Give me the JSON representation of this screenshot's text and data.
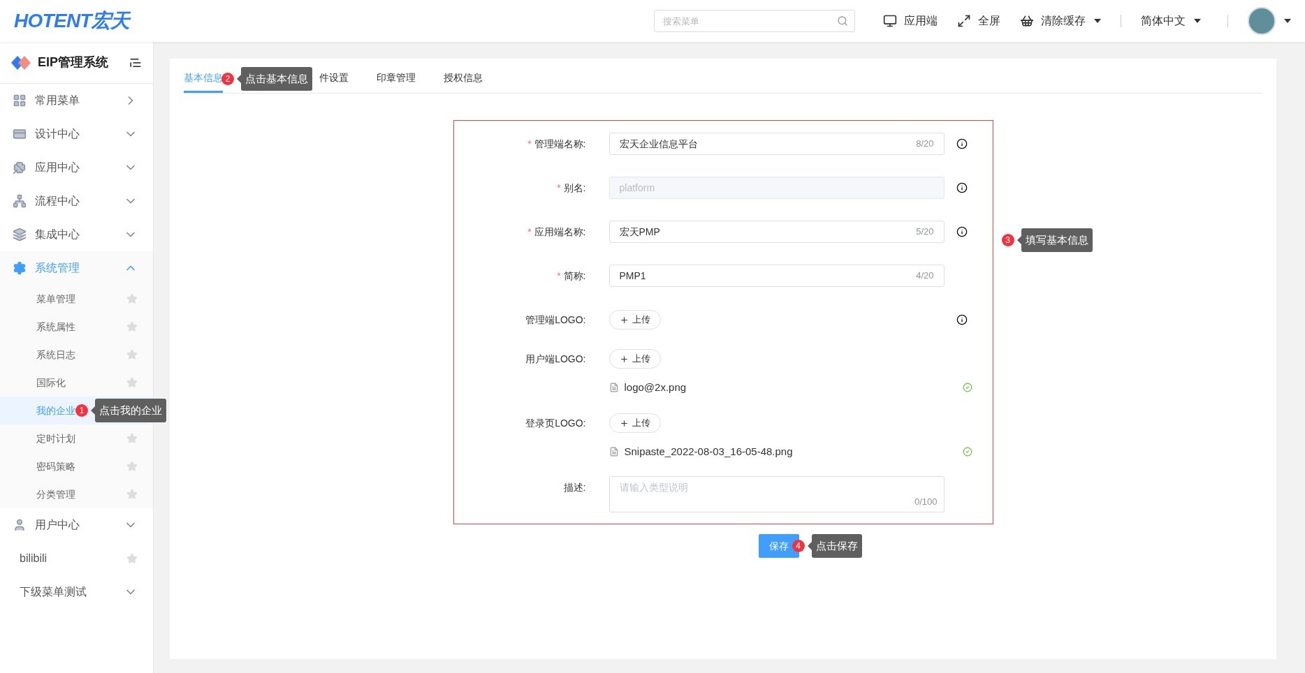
{
  "header": {
    "logo": "HOTENT宏天",
    "search": {
      "placeholder": "搜索菜单"
    },
    "actions": [
      {
        "label": "应用端",
        "dropdown": false
      },
      {
        "label": "全屏",
        "dropdown": false
      },
      {
        "label": "清除缓存",
        "dropdown": true
      }
    ],
    "language": "简体中文"
  },
  "sidebar": {
    "title": "EIP管理系统",
    "items": [
      {
        "kind": "flyout",
        "label": "常用菜单"
      },
      {
        "kind": "group",
        "label": "设计中心",
        "expanded": false
      },
      {
        "kind": "group",
        "label": "应用中心",
        "expanded": false
      },
      {
        "kind": "group",
        "label": "流程中心",
        "expanded": false
      },
      {
        "kind": "group",
        "label": "集成中心",
        "expanded": false
      },
      {
        "kind": "group",
        "label": "系统管理",
        "expanded": true,
        "children": [
          {
            "label": "菜单管理",
            "selected": false
          },
          {
            "label": "系统属性",
            "selected": false
          },
          {
            "label": "系统日志",
            "selected": false
          },
          {
            "label": "国际化",
            "selected": false
          },
          {
            "label": "我的企业",
            "selected": true,
            "annotation": {
              "number": "1",
              "text": "点击我的企业"
            }
          },
          {
            "label": "定时计划",
            "selected": false
          },
          {
            "label": "密码策略",
            "selected": false
          },
          {
            "label": "分类管理",
            "selected": false
          }
        ]
      },
      {
        "kind": "group",
        "label": "用户中心",
        "expanded": false
      },
      {
        "kind": "leaf",
        "label": "bilibili"
      },
      {
        "kind": "group",
        "label": "下级菜单测试",
        "expanded": false
      }
    ]
  },
  "tabs": [
    {
      "label": "基本信息",
      "selected": true,
      "annotation": {
        "number": "2",
        "text": "点击基本信息"
      }
    },
    {
      "label": "件设置",
      "selected": false
    },
    {
      "label": "印章管理",
      "selected": false
    },
    {
      "label": "授权信息",
      "selected": false
    }
  ],
  "form": {
    "annotation": {
      "number": "3",
      "text": "填写基本信息"
    },
    "fields": [
      {
        "kind": "input",
        "marker": "*",
        "label": "管理端名称:",
        "value": "宏天企业信息平台",
        "counter": "8/20",
        "disabled": false,
        "info": true
      },
      {
        "kind": "input",
        "marker": "*",
        "label": "别名:",
        "value": "platform",
        "disabled": true,
        "info": true
      },
      {
        "kind": "input",
        "marker": "*",
        "label": "应用端名称:",
        "value": "宏天PMP",
        "counter": "5/20",
        "disabled": false,
        "info": true
      },
      {
        "kind": "input",
        "marker": "*",
        "label": "简称:",
        "value": "PMP1",
        "counter": "4/20",
        "disabled": false,
        "info": false
      },
      {
        "kind": "upload",
        "label": "管理端LOGO:",
        "button": "上传",
        "info": true
      },
      {
        "kind": "upload",
        "label": "用户端LOGO:",
        "button": "上传",
        "info": false,
        "files": [
          "logo@2x.png"
        ]
      },
      {
        "kind": "upload",
        "label": "登录页LOGO:",
        "button": "上传",
        "info": false,
        "files": [
          "Snipaste_2022-08-03_16-05-48.png"
        ]
      },
      {
        "kind": "textarea",
        "label": "描述:",
        "placeholder": "请输入类型说明",
        "counter": "0/100"
      }
    ]
  },
  "save": {
    "label": "保存",
    "annotation": {
      "number": "4",
      "text": "点击保存"
    }
  }
}
